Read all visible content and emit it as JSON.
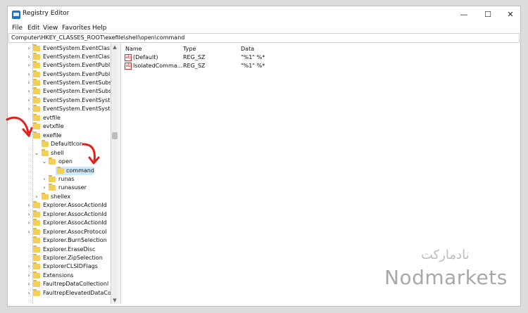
{
  "window": {
    "title": "Registry Editor",
    "controls": {
      "minimize": "—",
      "maximize": "☐",
      "close": "✕"
    }
  },
  "menu": [
    "File",
    "Edit",
    "View",
    "Favorites",
    "Help"
  ],
  "address": "Computer\\HKEY_CLASSES_ROOT\\exefile\\shell\\open\\command",
  "tree": [
    {
      "label": "EventSystem.EventClas"
    },
    {
      "label": "EventSystem.EventClas"
    },
    {
      "label": "EventSystem.EventPubl"
    },
    {
      "label": "EventSystem.EventPubl"
    },
    {
      "label": "EventSystem.EventSubs"
    },
    {
      "label": "EventSystem.EventSubs"
    },
    {
      "label": "EventSystem.EventSyste"
    },
    {
      "label": "EventSystem.EventSyste"
    },
    {
      "label": "evtfile"
    },
    {
      "label": "evtxfile"
    },
    {
      "label": "exefile"
    },
    {
      "label": "DefaultIcon"
    },
    {
      "label": "shell"
    },
    {
      "label": "open"
    },
    {
      "label": "command"
    },
    {
      "label": "runas"
    },
    {
      "label": "runasuser"
    },
    {
      "label": "shellex"
    },
    {
      "label": "Explorer.AssocActionId"
    },
    {
      "label": "Explorer.AssocActionId"
    },
    {
      "label": "Explorer.AssocActionId"
    },
    {
      "label": "Explorer.AssocProtocol"
    },
    {
      "label": "Explorer.BurnSelection"
    },
    {
      "label": "Explorer.EraseDisc"
    },
    {
      "label": "Explorer.ZipSelection"
    },
    {
      "label": "ExplorerCLSIDFlags"
    },
    {
      "label": "Extensions"
    },
    {
      "label": "FaultrepDataCollectionl"
    },
    {
      "label": "FaultrepElevatedDataCo"
    }
  ],
  "columns": {
    "name": "Name",
    "type": "Type",
    "data": "Data"
  },
  "values": [
    {
      "icon": "ab",
      "name": "(Default)",
      "type": "REG_SZ",
      "data": "\"%1\" %*"
    },
    {
      "icon": "ab",
      "name": "IsolatedComma...",
      "type": "REG_SZ",
      "data": "\"%1\" %*"
    }
  ],
  "watermark": {
    "arabic": "نادمارکت",
    "english": "Nodmarkets"
  },
  "colors": {
    "annotation_arrow": "#e0201b",
    "folder": "#f4cf58",
    "selection": "#cde8ff"
  }
}
